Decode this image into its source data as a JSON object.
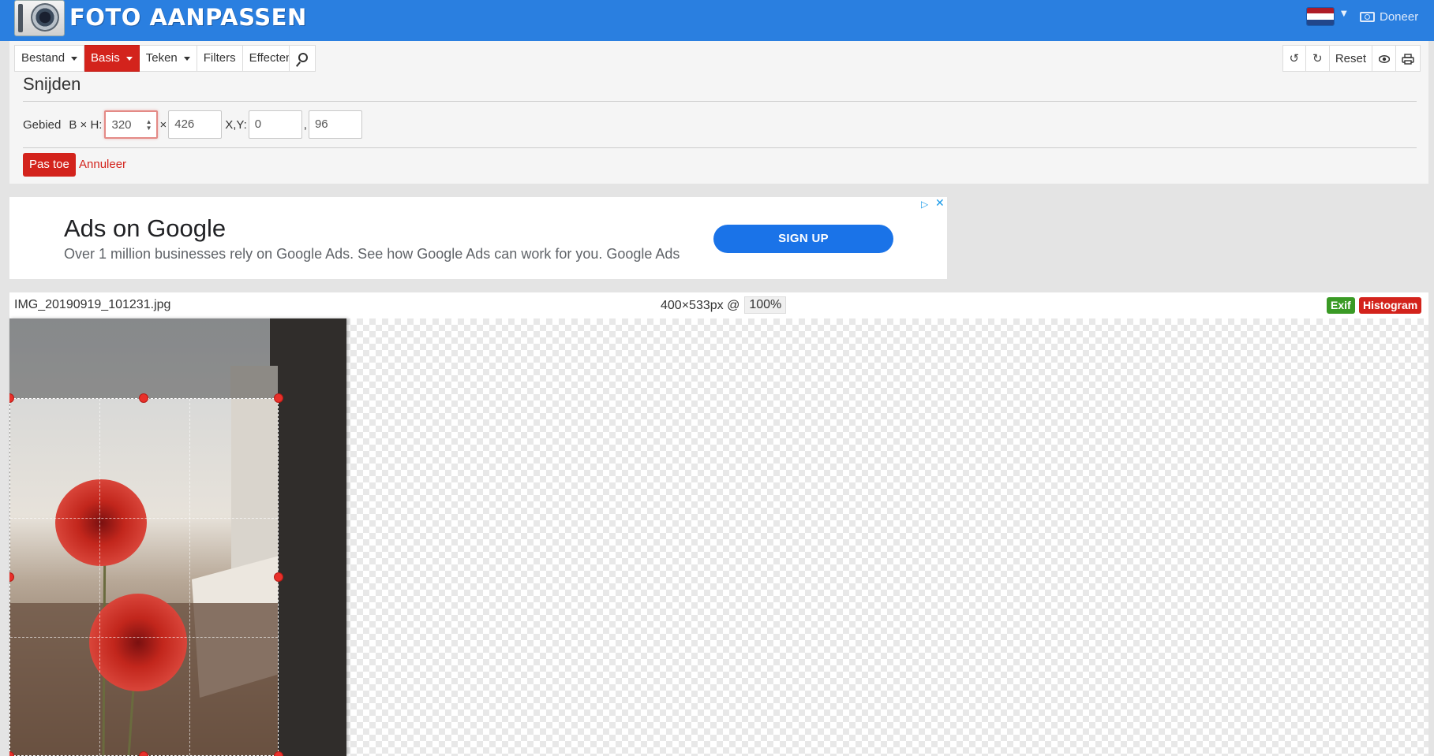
{
  "header": {
    "logo_text": "FOTO AANPASSEN",
    "language_flag": "nl-flag-icon",
    "donate_label": "Doneer"
  },
  "menu": {
    "items": [
      {
        "label": "Bestand",
        "dropdown": true,
        "active": false
      },
      {
        "label": "Basis",
        "dropdown": true,
        "active": true
      },
      {
        "label": "Teken",
        "dropdown": true,
        "active": false
      },
      {
        "label": "Filters",
        "dropdown": false,
        "active": false
      },
      {
        "label": "Effecten",
        "dropdown": false,
        "active": false
      }
    ],
    "search_icon": "search-icon",
    "right": {
      "undo_icon": "undo-icon",
      "redo_icon": "redo-icon",
      "reset_label": "Reset",
      "preview_icon": "eye-icon",
      "print_icon": "print-icon"
    }
  },
  "crop_panel": {
    "title": "Snijden",
    "area_label": "Gebied",
    "size_label": "B × H:",
    "width": "320",
    "times": "×",
    "height": "426",
    "position_label": "X,Y:",
    "x": "0",
    "comma": ",",
    "y": "96",
    "apply_label": "Pas toe",
    "cancel_label": "Annuleer"
  },
  "ad": {
    "title": "Ads on Google",
    "text": "Over 1 million businesses rely on Google Ads. See how Google Ads can work for you. Google Ads",
    "cta": "SIGN UP"
  },
  "image_bar": {
    "filename": "IMG_20190919_101231.jpg",
    "dimensions": "400×533px @",
    "zoom": "100%",
    "exif_label": "Exif",
    "histogram_label": "Histogram"
  },
  "colors": {
    "brand_blue": "#2a7fe0",
    "accent_red": "#d3231c",
    "exif_green": "#3a9a25"
  }
}
